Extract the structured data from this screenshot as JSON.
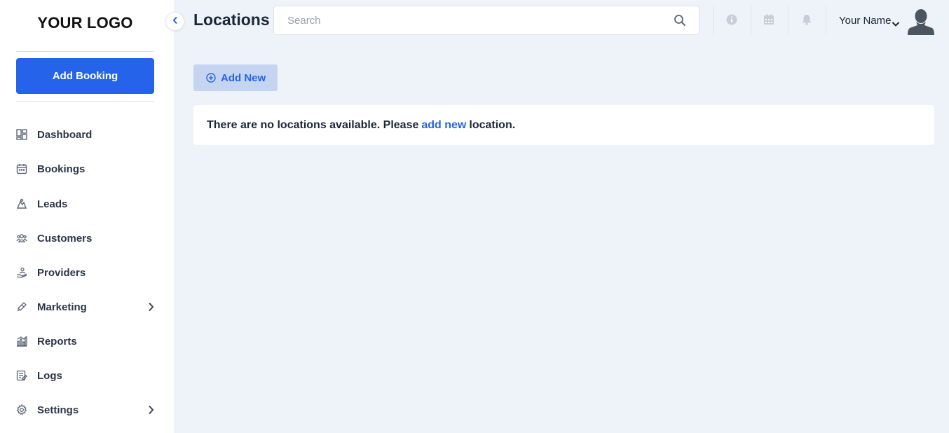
{
  "sidebar": {
    "logo": "YOUR LOGO",
    "add_booking_label": "Add Booking",
    "items": [
      {
        "label": "Dashboard",
        "icon": "dashboard-icon"
      },
      {
        "label": "Bookings",
        "icon": "calendar-icon"
      },
      {
        "label": "Leads",
        "icon": "leads-icon"
      },
      {
        "label": "Customers",
        "icon": "customers-icon"
      },
      {
        "label": "Providers",
        "icon": "providers-icon"
      },
      {
        "label": "Marketing",
        "icon": "megaphone-icon",
        "has_submenu": true
      },
      {
        "label": "Reports",
        "icon": "chart-icon"
      },
      {
        "label": "Logs",
        "icon": "logs-icon"
      },
      {
        "label": "Settings",
        "icon": "gear-icon",
        "has_submenu": true
      }
    ]
  },
  "header": {
    "title": "Locations",
    "search_placeholder": "Search",
    "search_value": "",
    "user_name": "Your Name",
    "icons": [
      "info-icon",
      "calendar-icon",
      "bell-icon"
    ]
  },
  "main": {
    "add_new_label": "Add New",
    "empty_message": {
      "prefix": "There are no locations available. Please",
      "link": "add new",
      "suffix": "location."
    }
  },
  "colors": {
    "accent": "#2563eb",
    "background": "#eef3f9",
    "add_new_bg": "#c5d5f1"
  }
}
